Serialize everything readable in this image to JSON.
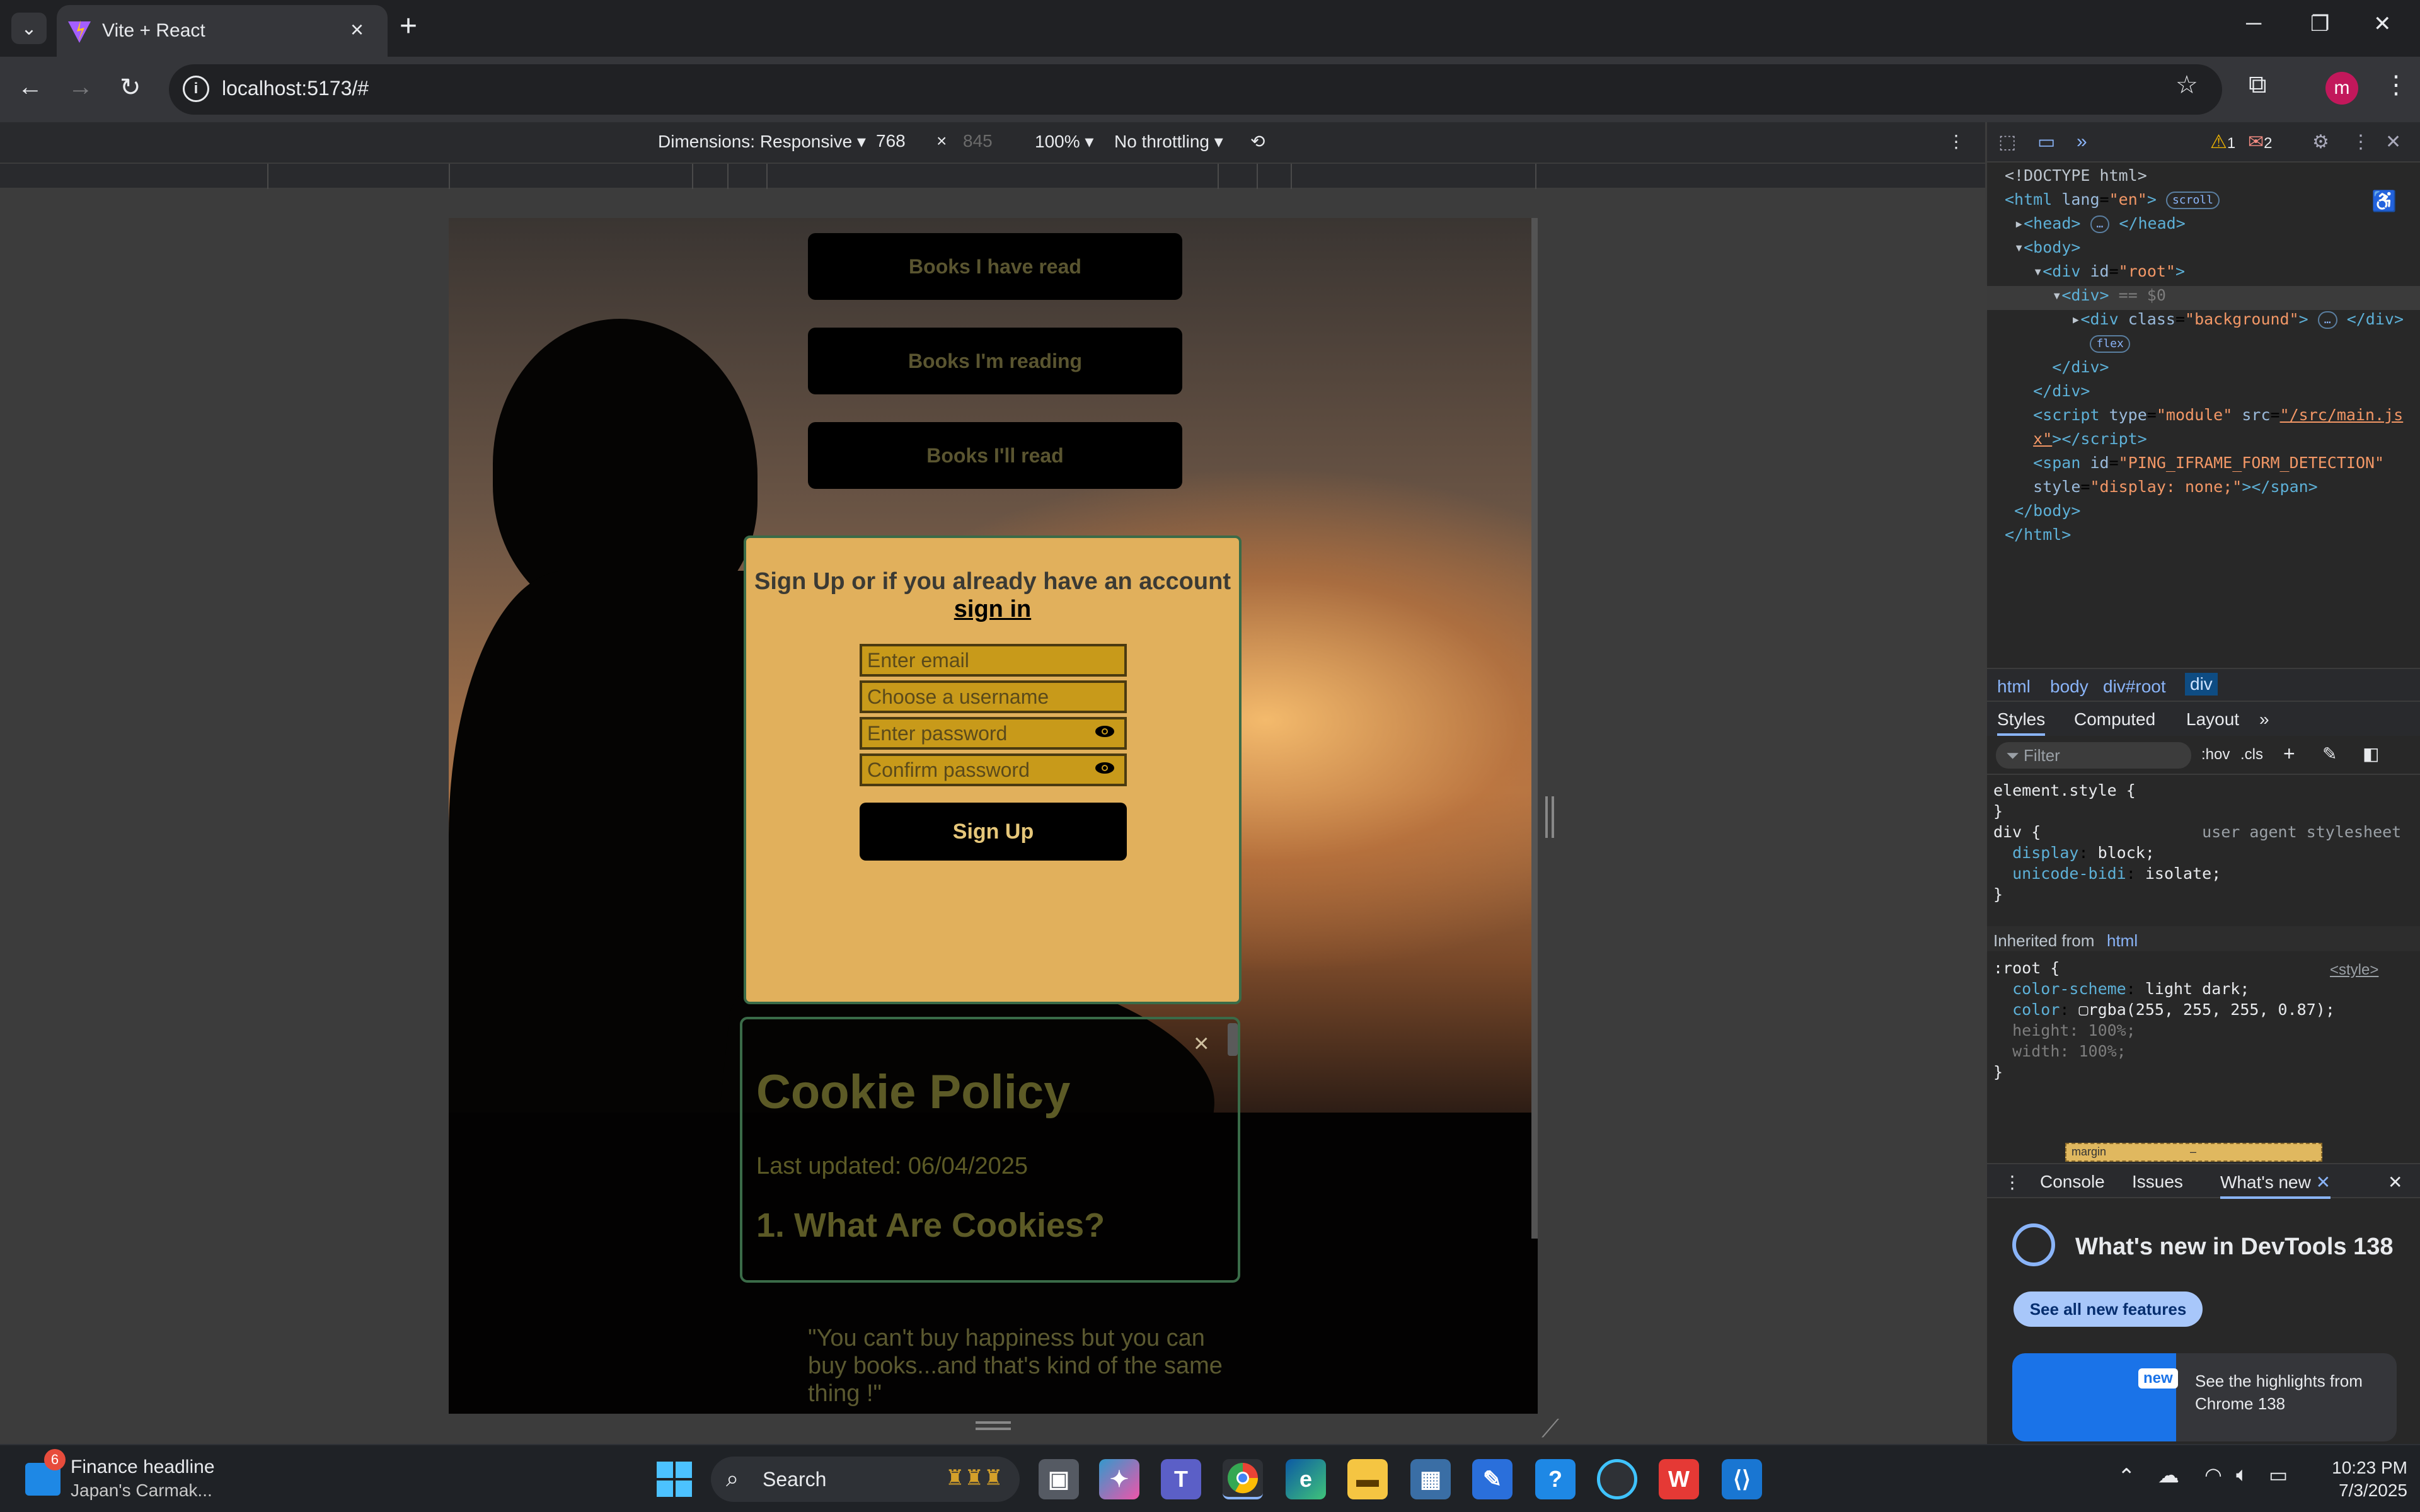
{
  "browser": {
    "tab_title": "Vite + React",
    "url": "localhost:5173/#",
    "new_tab": "+",
    "close": "×"
  },
  "device_toolbar": {
    "dimensions_label": "Dimensions: Responsive",
    "width": "768",
    "times": "×",
    "height": "845",
    "zoom": "100%",
    "throttling": "No throttling"
  },
  "page": {
    "nav_buttons": [
      "Books I have read",
      "Books I'm reading",
      "Books I'll read"
    ],
    "signup": {
      "title": "Sign Up or if you already have an account",
      "signin_link": "sign in",
      "email_placeholder": "Enter email",
      "username_placeholder": "Choose a username",
      "password_placeholder": "Enter password",
      "confirm_placeholder": "Confirm password",
      "submit_label": "Sign Up"
    },
    "cookie": {
      "close": "×",
      "title": "Cookie Policy",
      "updated": "Last updated: 06/04/2025",
      "section1": "1. What Are Cookies?"
    },
    "quote": "\"You can't buy happiness but you can buy books...and that's kind of the same thing !\""
  },
  "devtools": {
    "warnings": "1",
    "errors": "2",
    "crumbs": [
      "html",
      "body",
      "div#root",
      "div"
    ],
    "style_tabs": [
      "Styles",
      "Computed",
      "Layout"
    ],
    "filter_placeholder": "Filter",
    "hov": ":hov",
    "cls": ".cls",
    "element_style": "element.style {",
    "ua_label": "user agent stylesheet",
    "inherited_label": "Inherited from",
    "inherited_from": "html",
    "style_src": "<style>",
    "drawer_tabs": [
      "Console",
      "Issues",
      "What's new"
    ],
    "whats_new_title": "What's new in DevTools 138",
    "see_all": "See all new features",
    "card_new": "new",
    "card_text": "See the highlights from Chrome 138",
    "box_label": "margin",
    "box_value": "–"
  },
  "taskbar": {
    "news_badge": "6",
    "news_title": "Finance headline",
    "news_sub": "Japan's Carmak...",
    "search_label": "Search",
    "time": "10:23 PM",
    "date": "7/3/2025"
  },
  "colors": {
    "signup_bg": "#e1b05c",
    "accent_blue": "#8ab4f8",
    "button_black": "#000000"
  }
}
